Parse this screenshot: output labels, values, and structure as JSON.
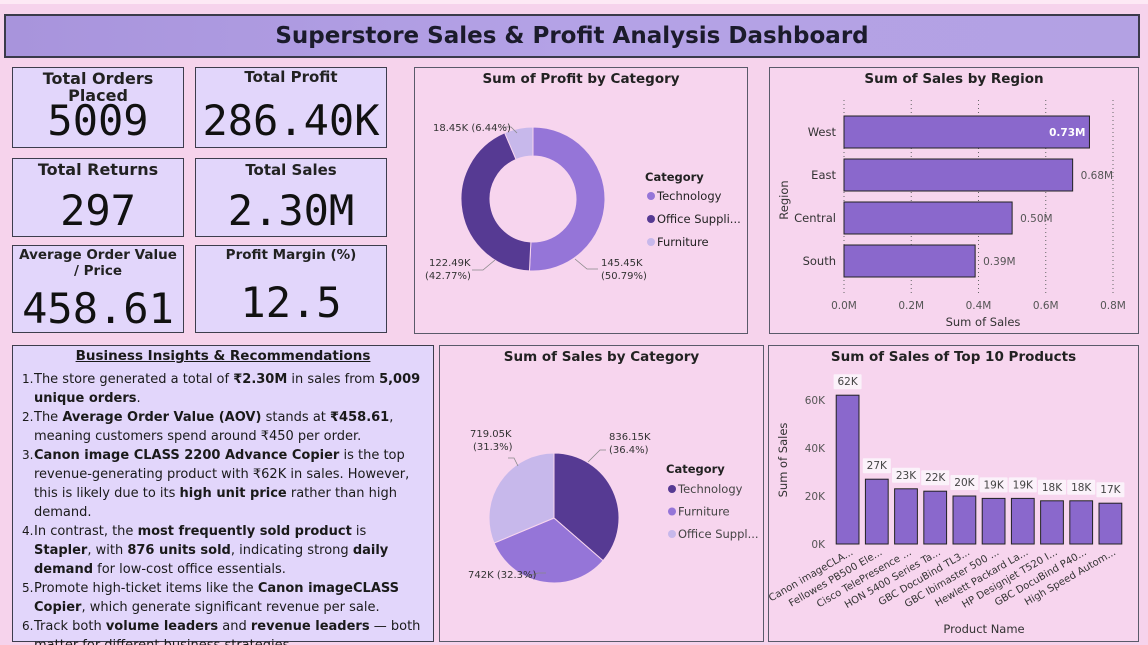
{
  "title": "Superstore Sales & Profit Analysis Dashboard",
  "kpis": {
    "total_orders": {
      "label": "Total Orders Placed",
      "value": "5009"
    },
    "total_profit": {
      "label": "Total Profit",
      "value": "286.40K"
    },
    "total_returns": {
      "label": "Total Returns",
      "value": "297"
    },
    "total_sales": {
      "label": "Total Sales",
      "value": "2.30M"
    },
    "aov": {
      "label": "Average Order Value / Price",
      "value": "458.61"
    },
    "profit_margin": {
      "label": "Profit Margin (%)",
      "value": "12.5"
    }
  },
  "insights": {
    "title": "Business Insights & Recommendations",
    "items": [
      {
        "num": "1.",
        "segs": [
          {
            "t": "The store generated a total of "
          },
          {
            "t": "₹2.30M",
            "b": true
          },
          {
            "t": " in sales from "
          },
          {
            "t": "5,009 unique orders",
            "b": true
          },
          {
            "t": "."
          }
        ]
      },
      {
        "num": "2.",
        "segs": [
          {
            "t": "The "
          },
          {
            "t": "Average Order Value (AOV)",
            "b": true
          },
          {
            "t": " stands at "
          },
          {
            "t": "₹458.61",
            "b": true
          },
          {
            "t": ", meaning customers spend around ₹450 per order."
          }
        ]
      },
      {
        "num": "3.",
        "segs": [
          {
            "t": "Canon image CLASS 2200 Advance Copier",
            "b": true
          },
          {
            "t": " is the top revenue-generating product with ₹62K in sales. However, this is likely due to its "
          },
          {
            "t": "high unit price",
            "b": true
          },
          {
            "t": " rather than high demand."
          }
        ]
      },
      {
        "num": "4.",
        "segs": [
          {
            "t": " In contrast, the "
          },
          {
            "t": "most frequently sold product",
            "b": true
          },
          {
            "t": " is "
          },
          {
            "t": "Stapler",
            "b": true
          },
          {
            "t": ", with "
          },
          {
            "t": "876 units sold",
            "b": true
          },
          {
            "t": ", indicating strong "
          },
          {
            "t": "daily demand",
            "b": true
          },
          {
            "t": " for low-cost office essentials."
          }
        ]
      },
      {
        "num": "5.",
        "segs": [
          {
            "t": "Promote high-ticket items like the "
          },
          {
            "t": "Canon imageCLASS Copier",
            "b": true
          },
          {
            "t": ", which generate significant revenue per sale."
          }
        ]
      },
      {
        "num": "6.",
        "segs": [
          {
            "t": "Track both "
          },
          {
            "t": "volume leaders",
            "b": true
          },
          {
            "t": " and "
          },
          {
            "t": "revenue leaders",
            "b": true
          },
          {
            "t": " — both matter for different business strategies."
          }
        ]
      }
    ]
  },
  "colors": {
    "technology": "#9575d8",
    "office": "#563a93",
    "furniture": "#c7b8eb",
    "bar": "#8a68cc"
  },
  "chart_data": [
    {
      "id": "profit_by_category",
      "type": "donut",
      "title": "Sum of Profit by Category",
      "legend_title": "Category",
      "legend": [
        "Technology",
        "Office Suppli...",
        "Furniture"
      ],
      "slices": [
        {
          "name": "Technology",
          "value": 145.45,
          "label": "145.45K",
          "pct": "(50.79%)"
        },
        {
          "name": "Office Supplies",
          "value": 122.49,
          "label": "122.49K",
          "pct": "(42.77%)"
        },
        {
          "name": "Furniture",
          "value": 18.45,
          "label": "18.45K (6.44%)",
          "pct": ""
        }
      ]
    },
    {
      "id": "sales_by_region",
      "type": "bar",
      "orientation": "horizontal",
      "title": "Sum of Sales by Region",
      "xlabel": "Sum of Sales",
      "ylabel": "Region",
      "categories": [
        "West",
        "East",
        "Central",
        "South"
      ],
      "values": [
        0.73,
        0.68,
        0.5,
        0.39
      ],
      "value_labels": [
        "0.73M",
        "0.68M",
        "0.50M",
        "0.39M"
      ],
      "xticks": [
        "0.0M",
        "0.2M",
        "0.4M",
        "0.6M",
        "0.8M"
      ],
      "xlim": [
        0,
        0.8
      ],
      "grid": true
    },
    {
      "id": "sales_by_category",
      "type": "pie",
      "title": "Sum of Sales by Category",
      "legend_title": "Category",
      "legend": [
        "Technology",
        "Furniture",
        "Office Suppl..."
      ],
      "slices": [
        {
          "name": "Technology",
          "value": 836.15,
          "label": "836.15K",
          "pct": "(36.4%)"
        },
        {
          "name": "Furniture",
          "value": 742,
          "label": "742K (32.3%)",
          "pct": ""
        },
        {
          "name": "Office Supplies",
          "value": 719.05,
          "label": "719.05K",
          "pct": "(31.3%)"
        }
      ]
    },
    {
      "id": "top10_products",
      "type": "bar",
      "title": "Sum of Sales of Top 10 Products",
      "xlabel": "Product Name",
      "ylabel": "Sum of Sales",
      "categories": [
        "Canon imageCLA...",
        "Fellowes PB500 Ele...",
        "Cisco TelePresence ...",
        "HON 5400 Series Ta...",
        "GBC DocuBind TL3...",
        "GBC Ibimaster 500 ...",
        "Hewlett Packard La...",
        "HP Designjet T520 I...",
        "GBC DocuBind P40...",
        "High Speed Autom..."
      ],
      "values": [
        62,
        27,
        23,
        22,
        20,
        19,
        19,
        18,
        18,
        17
      ],
      "value_labels": [
        "62K",
        "27K",
        "23K",
        "22K",
        "20K",
        "19K",
        "19K",
        "18K",
        "18K",
        "17K"
      ],
      "yticks": [
        "0K",
        "20K",
        "40K",
        "60K"
      ],
      "ylim": [
        0,
        70
      ]
    }
  ]
}
